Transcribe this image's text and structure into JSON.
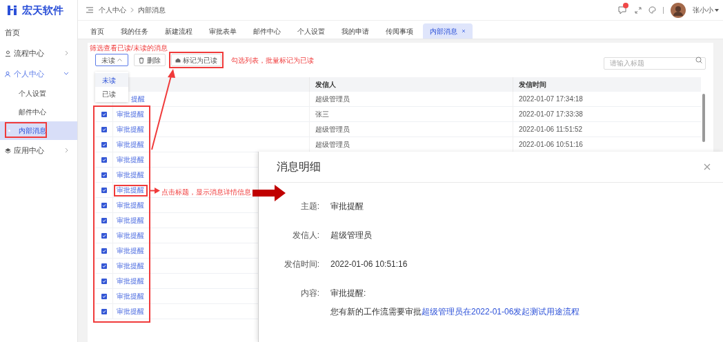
{
  "brand": {
    "name": "宏天软件"
  },
  "sidebar": {
    "items": [
      {
        "label": "首页",
        "expanded": false,
        "selected": false
      },
      {
        "label": "流程中心",
        "expanded": false,
        "selected": false
      },
      {
        "label": "个人中心",
        "expanded": true,
        "selected": false,
        "children": [
          {
            "label": "个人设置",
            "selected": false
          },
          {
            "label": "邮件中心",
            "selected": false
          },
          {
            "label": "内部消息",
            "selected": true
          }
        ]
      },
      {
        "label": "应用中心",
        "expanded": false,
        "selected": false
      }
    ]
  },
  "breadcrumb": [
    "个人中心",
    "内部消息"
  ],
  "header": {
    "user": "张小小",
    "notification_badge": true
  },
  "tabs": [
    {
      "label": "首页",
      "selected": false
    },
    {
      "label": "我的任务",
      "selected": false
    },
    {
      "label": "新建流程",
      "selected": false
    },
    {
      "label": "审批表单",
      "selected": false
    },
    {
      "label": "邮件中心",
      "selected": false
    },
    {
      "label": "个人设置",
      "selected": false
    },
    {
      "label": "我的申请",
      "selected": false
    },
    {
      "label": "传阅事项",
      "selected": false
    },
    {
      "label": "内部消息",
      "selected": true,
      "closable": true
    }
  ],
  "toolbar": {
    "filter": {
      "value": "未读",
      "options": [
        {
          "label": "未读",
          "selected": true
        },
        {
          "label": "已读",
          "selected": false
        }
      ]
    },
    "delete_button": "删除",
    "mark_read_button": "标记为已读",
    "search": {
      "placeholder": "请输入标题"
    }
  },
  "table": {
    "columns": [
      "发信人",
      "发信时间"
    ],
    "rows": [
      {
        "title": "提醒",
        "sender": "超级管理员",
        "time": "2022-01-07 17:34:18"
      },
      {
        "title": "审批提醒",
        "checked": true,
        "sender": "张三",
        "time": "2022-01-07 17:33:38"
      },
      {
        "title": "审批提醒",
        "checked": true,
        "sender": "超级管理员",
        "time": "2022-01-06 11:51:52"
      },
      {
        "title": "审批提醒",
        "checked": true,
        "sender": "超级管理员",
        "time": "2022-01-06 10:51:16"
      },
      {
        "title": "审批提醒",
        "checked": true
      },
      {
        "title": "审批提醒",
        "checked": true
      },
      {
        "title": "审批提醒",
        "checked": true
      },
      {
        "title": "审批提醒",
        "checked": true
      },
      {
        "title": "审批提醒",
        "checked": true
      },
      {
        "title": "审批提醒",
        "checked": true
      },
      {
        "title": "审批提醒",
        "checked": true
      },
      {
        "title": "审批提醒",
        "checked": true
      },
      {
        "title": "审批提醒",
        "checked": true
      },
      {
        "title": "审批提醒",
        "checked": true
      },
      {
        "title": "审批提醒",
        "checked": true
      }
    ]
  },
  "annotations": {
    "filter_note": "筛选查看已读/未读的消息",
    "mark_note": "勾选列表，批量标记为已读",
    "click_note": "点击标题，显示消息详情信息"
  },
  "detail": {
    "title": "消息明细",
    "fields": [
      {
        "label": "主题:",
        "value": "审批提醒"
      },
      {
        "label": "发信人:",
        "value": "超级管理员"
      },
      {
        "label": "发信时间:",
        "value": "2022-01-06 10:51:16"
      },
      {
        "label": "内容:",
        "value": "审批提醒:"
      }
    ],
    "content_text": "您有新的工作流需要审批",
    "content_link": "超级管理员在2022-01-06发起测试用途流程"
  }
}
